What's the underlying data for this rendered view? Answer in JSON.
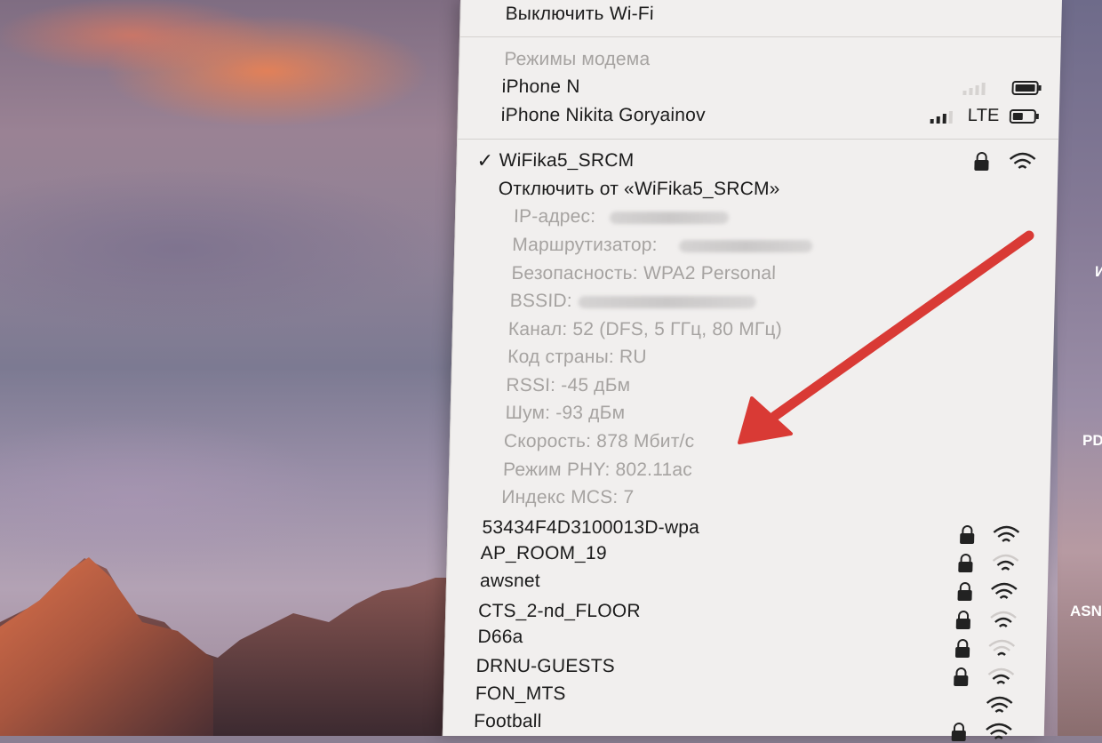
{
  "menu": {
    "turn_off_wifi": "Выключить Wi-Fi",
    "hotspot_header": "Режимы модема",
    "hotspots": [
      {
        "name": "iPhone N",
        "network_type": ""
      },
      {
        "name": "iPhone Nikita Goryainov",
        "network_type": "LTE"
      }
    ],
    "connected": {
      "name": "WiFika5_SRCM",
      "check": "✓",
      "disconnect": "Отключить от «WiFika5_SRCM»",
      "details": [
        "IP-адрес:",
        "Маршрутизатор:",
        "Безопасность: WPA2 Personal",
        "BSSID:",
        "Канал: 52 (DFS, 5 ГГц, 80 МГц)",
        "Код страны: RU",
        "RSSI: -45 дБм",
        "Шум: -93 дБм",
        "Скорость: 878 Мбит/с",
        "Режим PHY: 802.11ac",
        "Индекс MCS: 7"
      ]
    },
    "networks": [
      "53434F4D3100013D-wpa",
      "AP_ROOM_19",
      "awsnet",
      "CTS_2-nd_FLOOR",
      "D66a",
      "DRNU-GUESTS",
      "FON_MTS",
      "Football"
    ]
  },
  "edge_labels": [
    "И",
    "PD",
    "ASN"
  ],
  "colors": {
    "arrow": "#d93a35",
    "menu_bg": "#f1efee",
    "text": "#1b1b1b",
    "disabled": "#a6a3a1"
  }
}
